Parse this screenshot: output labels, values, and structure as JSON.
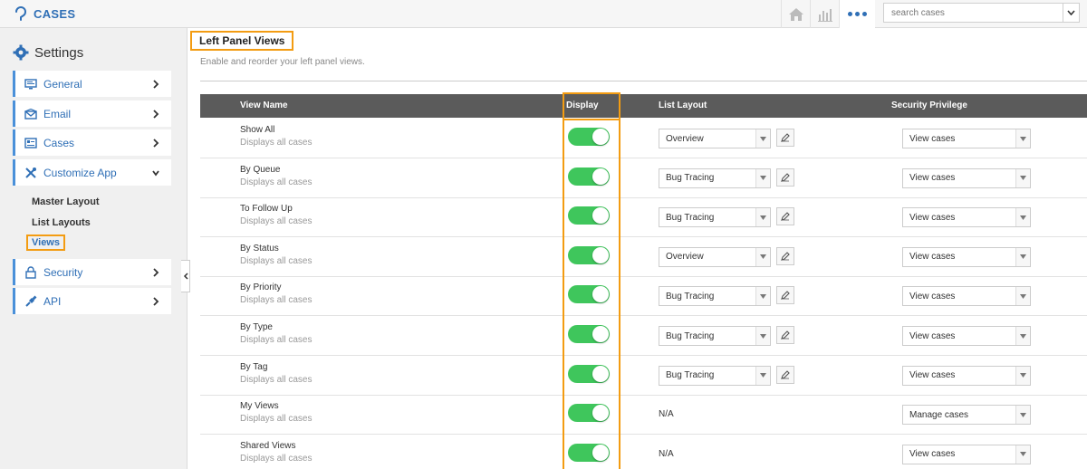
{
  "app": {
    "title": "CASES"
  },
  "search": {
    "placeholder": "search cases"
  },
  "sidebar": {
    "title": "Settings",
    "items": [
      {
        "label": "General"
      },
      {
        "label": "Email"
      },
      {
        "label": "Cases"
      },
      {
        "label": "Customize App"
      },
      {
        "label": "Security"
      },
      {
        "label": "API"
      }
    ],
    "sub_items": [
      {
        "label": "Master Layout"
      },
      {
        "label": "List Layouts"
      },
      {
        "label": "Views"
      }
    ]
  },
  "page": {
    "heading": "Left Panel Views",
    "description": "Enable and reorder your left panel views."
  },
  "table": {
    "columns": [
      "View Name",
      "Display",
      "List Layout",
      "Security Privilege"
    ],
    "rows": [
      {
        "name": "Show All",
        "desc": "Displays all cases",
        "display": true,
        "layout": "Overview",
        "privilege": "View cases"
      },
      {
        "name": "By Queue",
        "desc": "Displays all cases",
        "display": true,
        "layout": "Bug Tracing",
        "privilege": "View cases"
      },
      {
        "name": "To Follow Up",
        "desc": "Displays all cases",
        "display": true,
        "layout": "Bug Tracing",
        "privilege": "View cases"
      },
      {
        "name": "By Status",
        "desc": "Displays all cases",
        "display": true,
        "layout": "Overview",
        "privilege": "View cases"
      },
      {
        "name": "By Priority",
        "desc": "Displays all cases",
        "display": true,
        "layout": "Bug Tracing",
        "privilege": "View cases"
      },
      {
        "name": "By Type",
        "desc": "Displays all cases",
        "display": true,
        "layout": "Bug Tracing",
        "privilege": "View cases"
      },
      {
        "name": "By Tag",
        "desc": "Displays all cases",
        "display": true,
        "layout": "Bug Tracing",
        "privilege": "View cases"
      },
      {
        "name": "My Views",
        "desc": "Displays all cases",
        "display": true,
        "layout": "N/A",
        "privilege": "Manage cases"
      },
      {
        "name": "Shared Views",
        "desc": "Displays all cases",
        "display": true,
        "layout": "N/A",
        "privilege": "View cases"
      }
    ]
  },
  "colors": {
    "accent": "#2f6fb6",
    "highlight": "#f39c12",
    "toggle_on": "#3fc65c",
    "header_bg": "#5b5b5b"
  }
}
